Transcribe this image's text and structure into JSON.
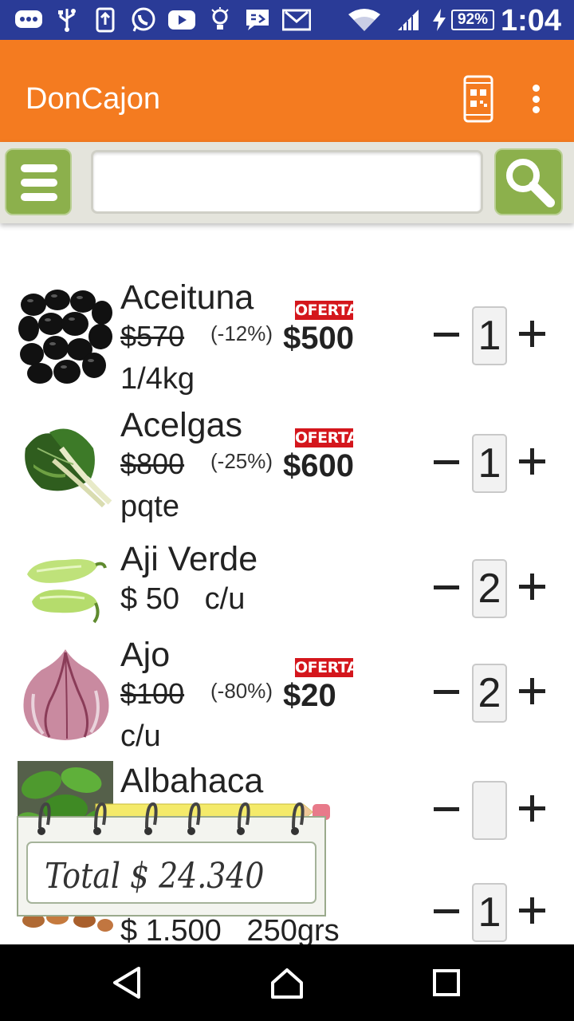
{
  "status_bar": {
    "battery": "92%",
    "time": "1:04",
    "icons": [
      "chat-icon",
      "usb-icon",
      "upload-icon",
      "whatsapp-icon",
      "youtube-icon",
      "lightbulb-icon",
      "message-icon",
      "gmail-icon",
      "wifi-icon",
      "signal-icon",
      "charging-icon"
    ]
  },
  "app_bar": {
    "title": "DonCajon",
    "qr_icon": "phone-qr-icon",
    "more_icon": "more-vert-icon"
  },
  "search": {
    "menu_icon": "menu-icon",
    "query": "",
    "search_icon": "search-icon"
  },
  "products": [
    {
      "name": "Aceituna",
      "old_price": "$570",
      "discount": "(-12%)",
      "price": "$500",
      "unit": "1/4kg",
      "badge": "OFERTA",
      "qty": "1",
      "image": "olives"
    },
    {
      "name": "Acelgas",
      "old_price": "$800",
      "discount": "(-25%)",
      "price": "$600",
      "unit": "pqte",
      "badge": "OFERTA",
      "qty": "1",
      "image": "chard"
    },
    {
      "name": "Aji Verde",
      "price_line": "$ 50   c/u",
      "qty": "2",
      "image": "green-pepper"
    },
    {
      "name": "Ajo",
      "old_price": "$100",
      "discount": "(-80%)",
      "price": "$20",
      "unit": "c/u",
      "badge": "OFERTA",
      "qty": "2",
      "image": "garlic"
    },
    {
      "name": "Albahaca",
      "qty": "",
      "image": "basil"
    },
    {
      "price_line": "$ 1.500   250grs",
      "qty": "1",
      "image": "almonds"
    }
  ],
  "total": {
    "label": "Total $ 24.340"
  },
  "nav": {
    "icons": [
      "back-icon",
      "home-icon",
      "recents-icon"
    ]
  },
  "colors": {
    "status_bar": "#2a3b97",
    "app_bar": "#f47b20",
    "button_green": "#8cb04c",
    "offer_red": "#d4161c"
  }
}
